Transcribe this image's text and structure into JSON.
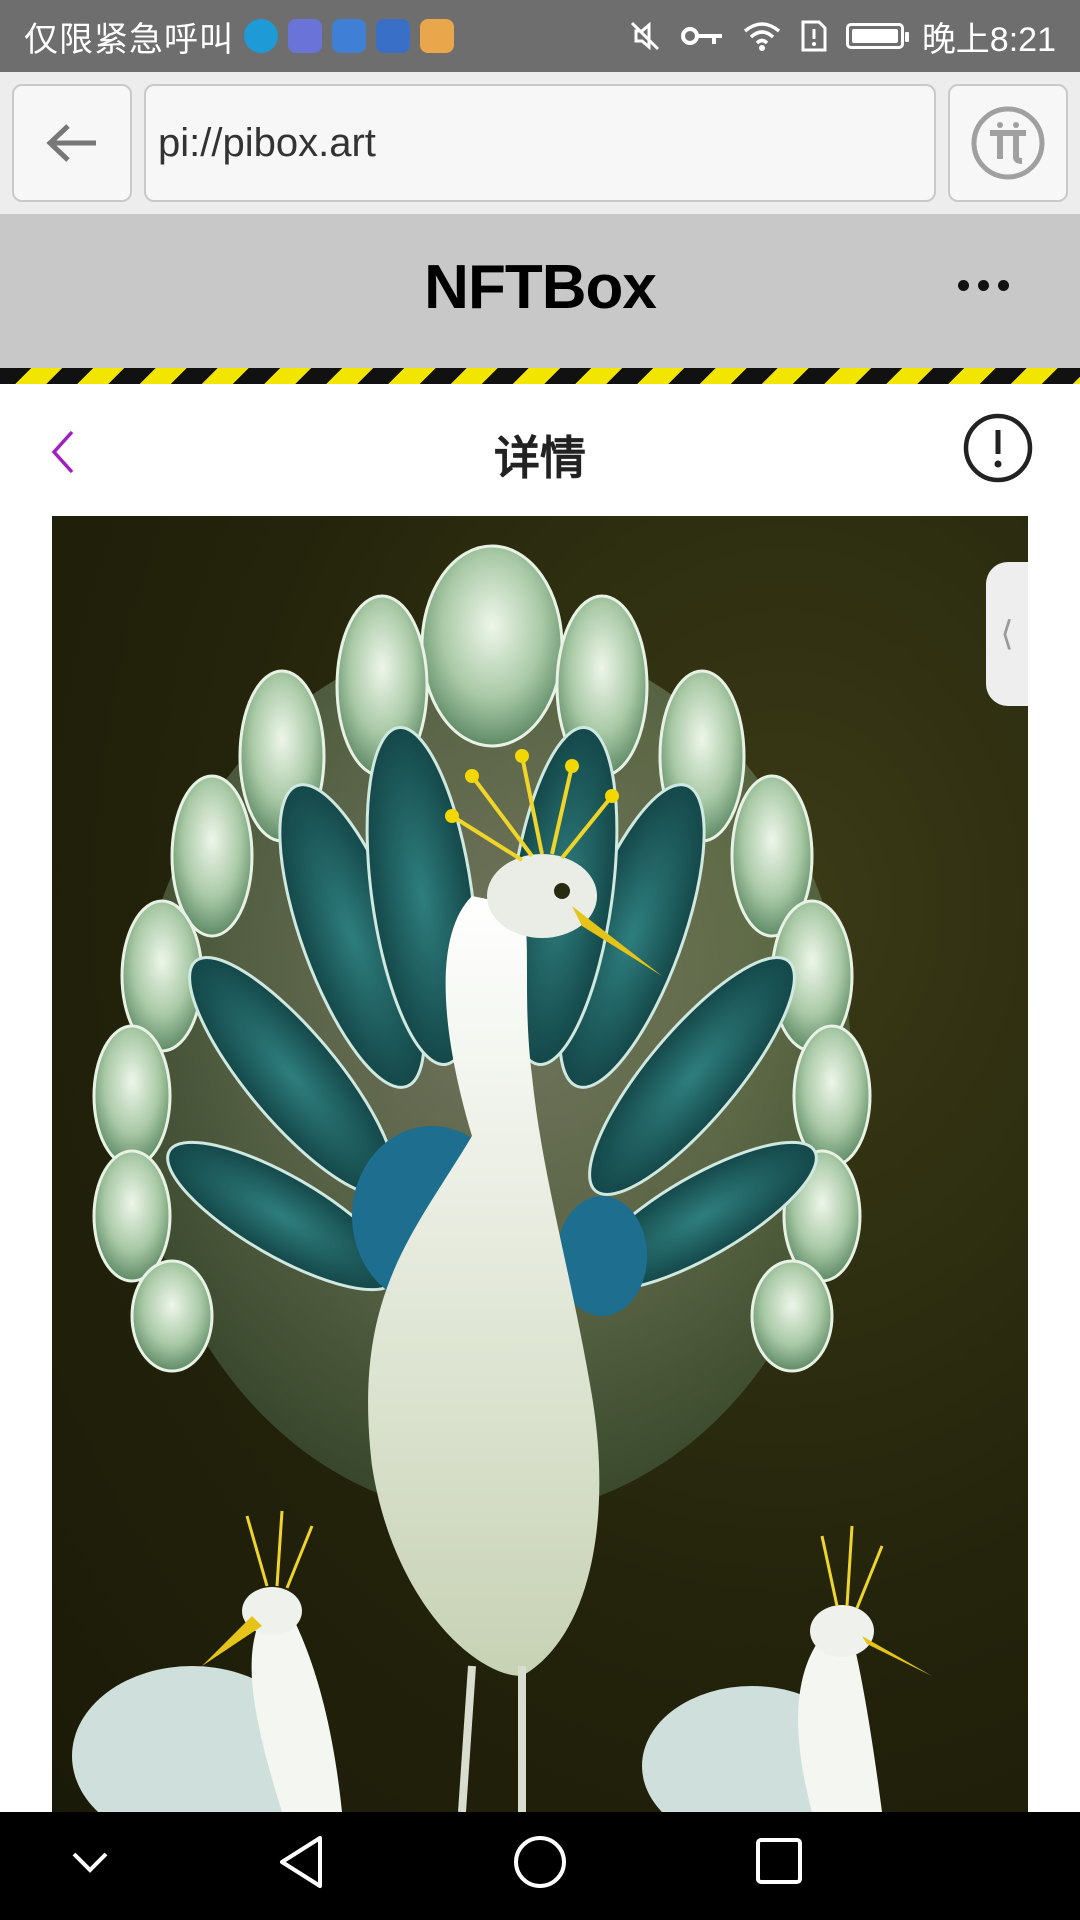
{
  "status_bar": {
    "carrier": "仅限紧急呼叫",
    "time": "晚上8:21",
    "notification_icons": [
      "weibo-icon",
      "music-icon",
      "browser-icon",
      "app-icon",
      "folder-icon"
    ],
    "system_icons": [
      "mute-icon",
      "key-icon",
      "wifi-icon",
      "sim-alert-icon",
      "battery-icon"
    ]
  },
  "browser": {
    "url": "pi://pibox.art"
  },
  "app": {
    "title": "NFTBox"
  },
  "page": {
    "title": "详情"
  },
  "artwork": {
    "description_icon": "peacock-artwork-image"
  },
  "colors": {
    "back_accent": "#a020c0",
    "hazard_yellow": "#f2e600",
    "header_gray": "#c8c8c8"
  }
}
